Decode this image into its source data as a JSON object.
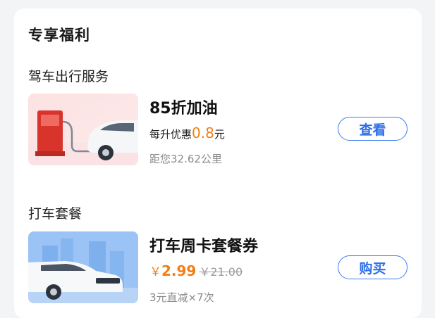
{
  "section": {
    "title": "专享福利"
  },
  "groups": [
    {
      "title": "驾车出行服务",
      "item": {
        "title": "85折加油",
        "detail_prefix": "每升优惠",
        "detail_value": "0.8",
        "detail_suffix": "元",
        "sub": "距您32.62公里",
        "button": "查看"
      }
    },
    {
      "title": "打车套餐",
      "item": {
        "title": "打车周卡套餐券",
        "price_symbol": "￥",
        "price": "2.99",
        "original_price": "￥21.00",
        "sub": "3元直减×7次",
        "button": "购买"
      }
    }
  ],
  "colors": {
    "accent": "#3c7cf0",
    "price": "#f07f17",
    "card_bg": "#ffffff",
    "page_bg": "#f3f4f6"
  }
}
